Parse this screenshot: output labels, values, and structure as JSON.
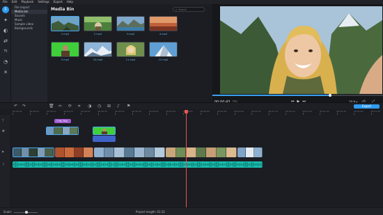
{
  "menu": [
    "File",
    "Edit",
    "Playback",
    "Settings",
    "Export",
    "Help"
  ],
  "tools": [
    {
      "name": "import-icon",
      "glyph": "⇩",
      "active": true
    },
    {
      "name": "magic-wand-icon",
      "glyph": "✦"
    },
    {
      "name": "filters-icon",
      "glyph": "◐"
    },
    {
      "name": "transitions-icon",
      "glyph": "⇄"
    },
    {
      "name": "titles-icon",
      "glyph": "Tt"
    },
    {
      "name": "stickers-icon",
      "glyph": "◔"
    },
    {
      "name": "more-tools-icon",
      "glyph": "✕"
    }
  ],
  "categories": [
    "File import",
    "Media bin",
    "Sounds",
    "Music",
    "Sample video",
    "Backgrounds"
  ],
  "active_category": "Media bin",
  "media_bin": {
    "title": "Media Bin",
    "search_placeholder": "Search",
    "items": [
      {
        "label": "1.mp4",
        "scene": "cliff",
        "selected": true
      },
      {
        "label": "2.mp4",
        "scene": "forest"
      },
      {
        "label": "3.mp4",
        "scene": "lake"
      },
      {
        "label": "4.mp4",
        "scene": "sunset"
      },
      {
        "label": "5.mp4",
        "scene": "greenscreen"
      },
      {
        "label": "10.mp4",
        "scene": "mountain"
      },
      {
        "label": "11.mp4",
        "scene": "selfie"
      },
      {
        "label": "12.mp4",
        "scene": "peak"
      }
    ]
  },
  "player": {
    "timecode": "00:00:43",
    "timecode_frac": ".750",
    "progress": 0.69,
    "aspect": "16:9 ▾",
    "transport": [
      "⏮",
      "▶",
      "⏭"
    ]
  },
  "toolbar": {
    "icons": [
      "undo-icon",
      "redo-icon",
      "delete-icon",
      "cut-icon",
      "rotate-icon",
      "crop-icon",
      "color-icon",
      "speed-icon",
      "volume-icon",
      "split-icon",
      "audio-icon",
      "overlay-icon",
      "flag-icon"
    ],
    "export_label": "Export"
  },
  "ruler_ticks": [
    "00:00:00",
    "00:00:05",
    "00:00:10",
    "00:00:15",
    "00:00:20",
    "00:00:25",
    "00:00:30",
    "00:00:35",
    "00:00:40",
    "00:00:45",
    "00:00:50",
    "00:00:55",
    "00:01:00",
    "00:01:05",
    "00:01:10",
    "00:01:15",
    "00:01:20",
    "00:01:25",
    "00:01:30",
    "00:01:35",
    "00:01:40",
    "00:01:45"
  ],
  "title_clip": {
    "label": "My Trip"
  },
  "status": {
    "scale_label": "Scale:",
    "project_length": "Project length: 01:32"
  },
  "colors": {
    "accent": "#2f9cf0",
    "playhead": "#ef5350",
    "audio": "#19bfb0",
    "title": "#9f5bd0"
  }
}
